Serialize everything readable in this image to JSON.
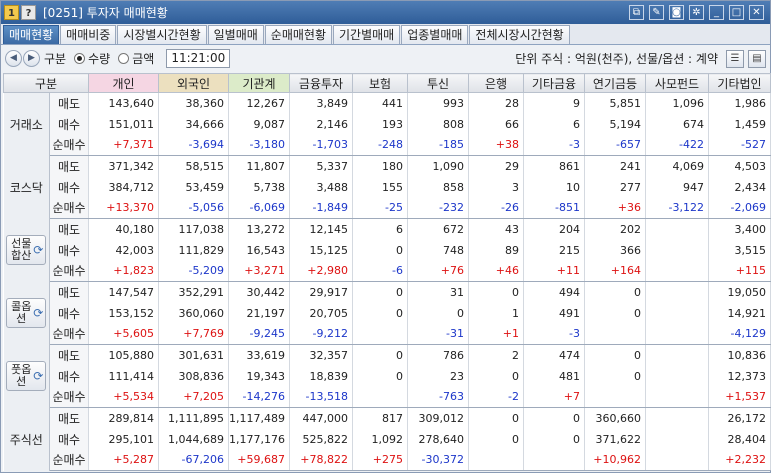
{
  "titlebar": {
    "badge1": "1",
    "badge2": "?",
    "title": "[0251] 투자자 매매현황",
    "icons": [
      "link-icon",
      "note-icon",
      "camera-icon",
      "gear-icon",
      "minimize-icon",
      "maximize-icon",
      "close-icon"
    ]
  },
  "tabs": [
    "매매현황",
    "매매비중",
    "시장별시간현황",
    "일별매매",
    "순매매현황",
    "기간별매매",
    "업종별매매",
    "전체시장시간현황"
  ],
  "controls": {
    "label": "구분",
    "radio_qty": "수량",
    "radio_amt": "금액",
    "time": "11:21:00",
    "unit_text": "단위 주식 : 억원(천주), 선물/옵션 : 계약"
  },
  "table": {
    "headers": [
      "구분",
      "개인",
      "외국인",
      "기관계",
      "금융투자",
      "보험",
      "투신",
      "은행",
      "기타금융",
      "연기금등",
      "사모펀드",
      "기타법인"
    ],
    "row_labels": [
      "매도",
      "매수",
      "순매수"
    ],
    "groups": [
      {
        "name": "거래소",
        "rows": [
          [
            "143,640",
            "38,360",
            "12,267",
            "3,849",
            "441",
            "993",
            "28",
            "9",
            "5,851",
            "1,096",
            "1,986"
          ],
          [
            "151,011",
            "34,666",
            "9,087",
            "2,146",
            "193",
            "808",
            "66",
            "6",
            "5,194",
            "674",
            "1,459"
          ],
          [
            "+7,371",
            "-3,694",
            "-3,180",
            "-1,703",
            "-248",
            "-185",
            "+38",
            "-3",
            "-657",
            "-422",
            "-527"
          ]
        ]
      },
      {
        "name": "코스닥",
        "rows": [
          [
            "371,342",
            "58,515",
            "11,807",
            "5,337",
            "180",
            "1,090",
            "29",
            "861",
            "241",
            "4,069",
            "4,503"
          ],
          [
            "384,712",
            "53,459",
            "5,738",
            "3,488",
            "155",
            "858",
            "3",
            "10",
            "277",
            "947",
            "2,434"
          ],
          [
            "+13,370",
            "-5,056",
            "-6,069",
            "-1,849",
            "-25",
            "-232",
            "-26",
            "-851",
            "+36",
            "-3,122",
            "-2,069"
          ]
        ]
      },
      {
        "name": "선물합산",
        "button": true,
        "rows": [
          [
            "40,180",
            "117,038",
            "13,272",
            "12,145",
            "6",
            "672",
            "43",
            "204",
            "202",
            "",
            "3,400"
          ],
          [
            "42,003",
            "111,829",
            "16,543",
            "15,125",
            "0",
            "748",
            "89",
            "215",
            "366",
            "",
            "3,515"
          ],
          [
            "+1,823",
            "-5,209",
            "+3,271",
            "+2,980",
            "-6",
            "+76",
            "+46",
            "+11",
            "+164",
            "",
            "+115"
          ]
        ]
      },
      {
        "name": "콜옵션",
        "button": true,
        "rows": [
          [
            "147,547",
            "352,291",
            "30,442",
            "29,917",
            "0",
            "31",
            "0",
            "494",
            "0",
            "",
            "19,050"
          ],
          [
            "153,152",
            "360,060",
            "21,197",
            "20,705",
            "0",
            "0",
            "1",
            "491",
            "0",
            "",
            "14,921"
          ],
          [
            "+5,605",
            "+7,769",
            "-9,245",
            "-9,212",
            "",
            "-31",
            "+1",
            "-3",
            "",
            "",
            "-4,129"
          ]
        ]
      },
      {
        "name": "풋옵션",
        "button": true,
        "rows": [
          [
            "105,880",
            "301,631",
            "33,619",
            "32,357",
            "0",
            "786",
            "2",
            "474",
            "0",
            "",
            "10,836"
          ],
          [
            "111,414",
            "308,836",
            "19,343",
            "18,839",
            "0",
            "23",
            "0",
            "481",
            "0",
            "",
            "12,373"
          ],
          [
            "+5,534",
            "+7,205",
            "-14,276",
            "-13,518",
            "",
            "-763",
            "-2",
            "+7",
            "",
            "",
            "+1,537"
          ]
        ]
      },
      {
        "name": "주식선",
        "rows": [
          [
            "289,814",
            "1,111,895",
            "1,117,489",
            "447,000",
            "817",
            "309,012",
            "0",
            "0",
            "360,660",
            "",
            "26,172"
          ],
          [
            "295,101",
            "1,044,689",
            "1,177,176",
            "525,822",
            "1,092",
            "278,640",
            "0",
            "0",
            "371,622",
            "",
            "28,404"
          ],
          [
            "+5,287",
            "-67,206",
            "+59,687",
            "+78,822",
            "+275",
            "-30,372",
            "",
            "",
            "+10,962",
            "",
            "+2,232"
          ]
        ]
      }
    ]
  },
  "colors": {
    "positive": "#d11111",
    "negative": "#1c36c9",
    "header_individual": "#f5d6e3",
    "header_foreign": "#ece0bf",
    "header_institution": "#dcebc9",
    "titlebar": "#3b6aa4"
  }
}
